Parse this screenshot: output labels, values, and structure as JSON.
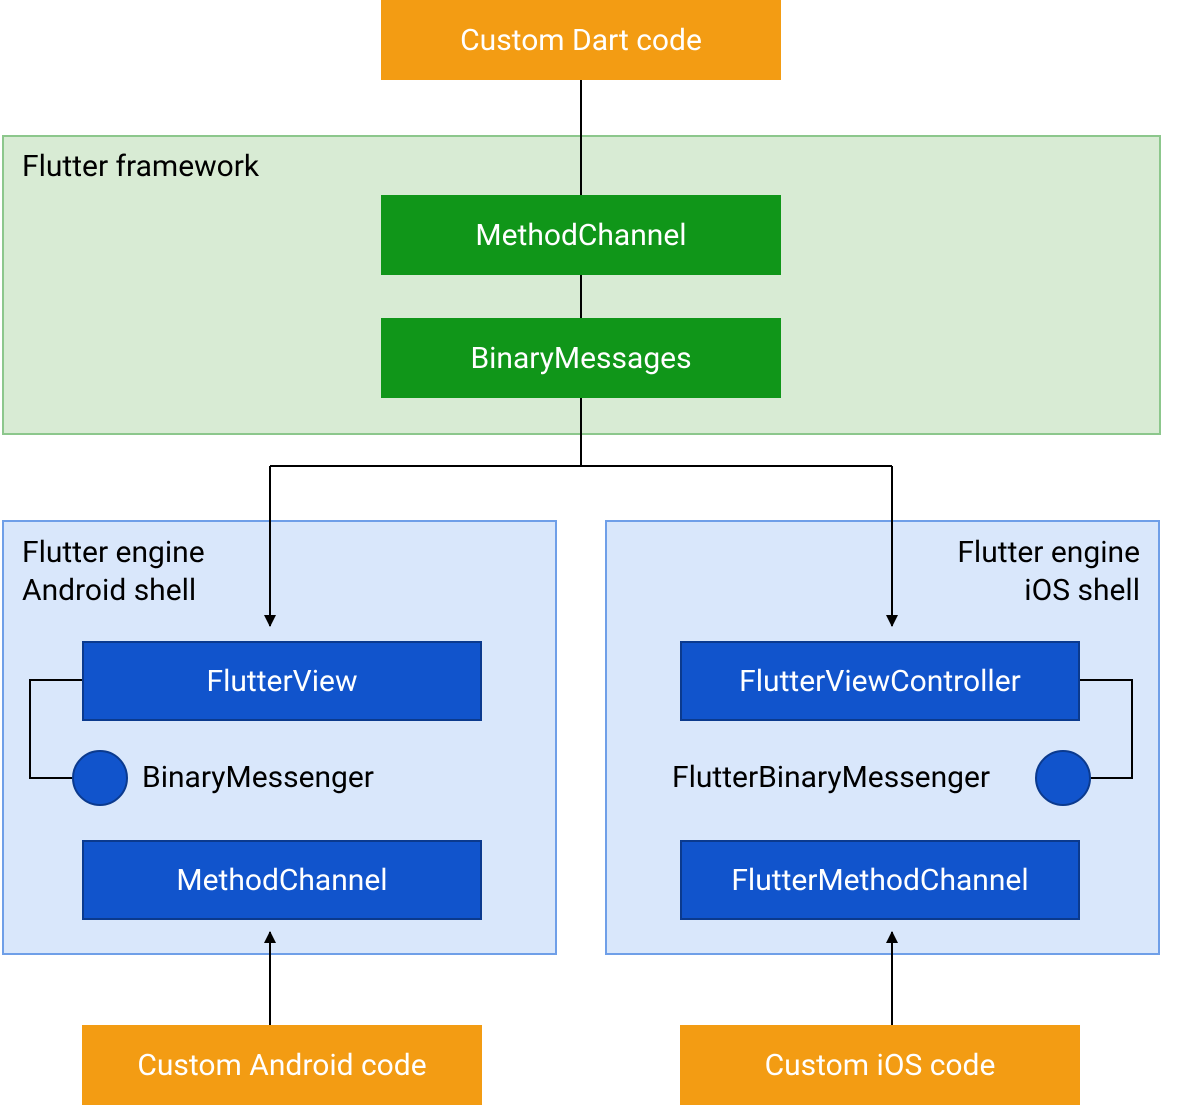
{
  "top": {
    "custom_dart_code": "Custom Dart code"
  },
  "framework": {
    "title": "Flutter framework",
    "method_channel": "MethodChannel",
    "binary_messages": "BinaryMessages"
  },
  "android": {
    "title_line1": "Flutter engine",
    "title_line2": "Android shell",
    "flutter_view": "FlutterView",
    "binary_messenger": "BinaryMessenger",
    "method_channel": "MethodChannel",
    "custom_code": "Custom Android code"
  },
  "ios": {
    "title_line1": "Flutter engine",
    "title_line2": "iOS shell",
    "flutter_view_controller": "FlutterViewController",
    "binary_messenger": "FlutterBinaryMessenger",
    "method_channel": "FlutterMethodChannel",
    "custom_code": "Custom iOS code"
  },
  "colors": {
    "orange": "#f39c13",
    "green_bg": "#d8ebd4",
    "green_border": "#8cc78c",
    "green_box": "#109619",
    "blue_bg": "#d9e7fb",
    "blue_border": "#6f9fe8",
    "blue_box": "#1154cc"
  }
}
